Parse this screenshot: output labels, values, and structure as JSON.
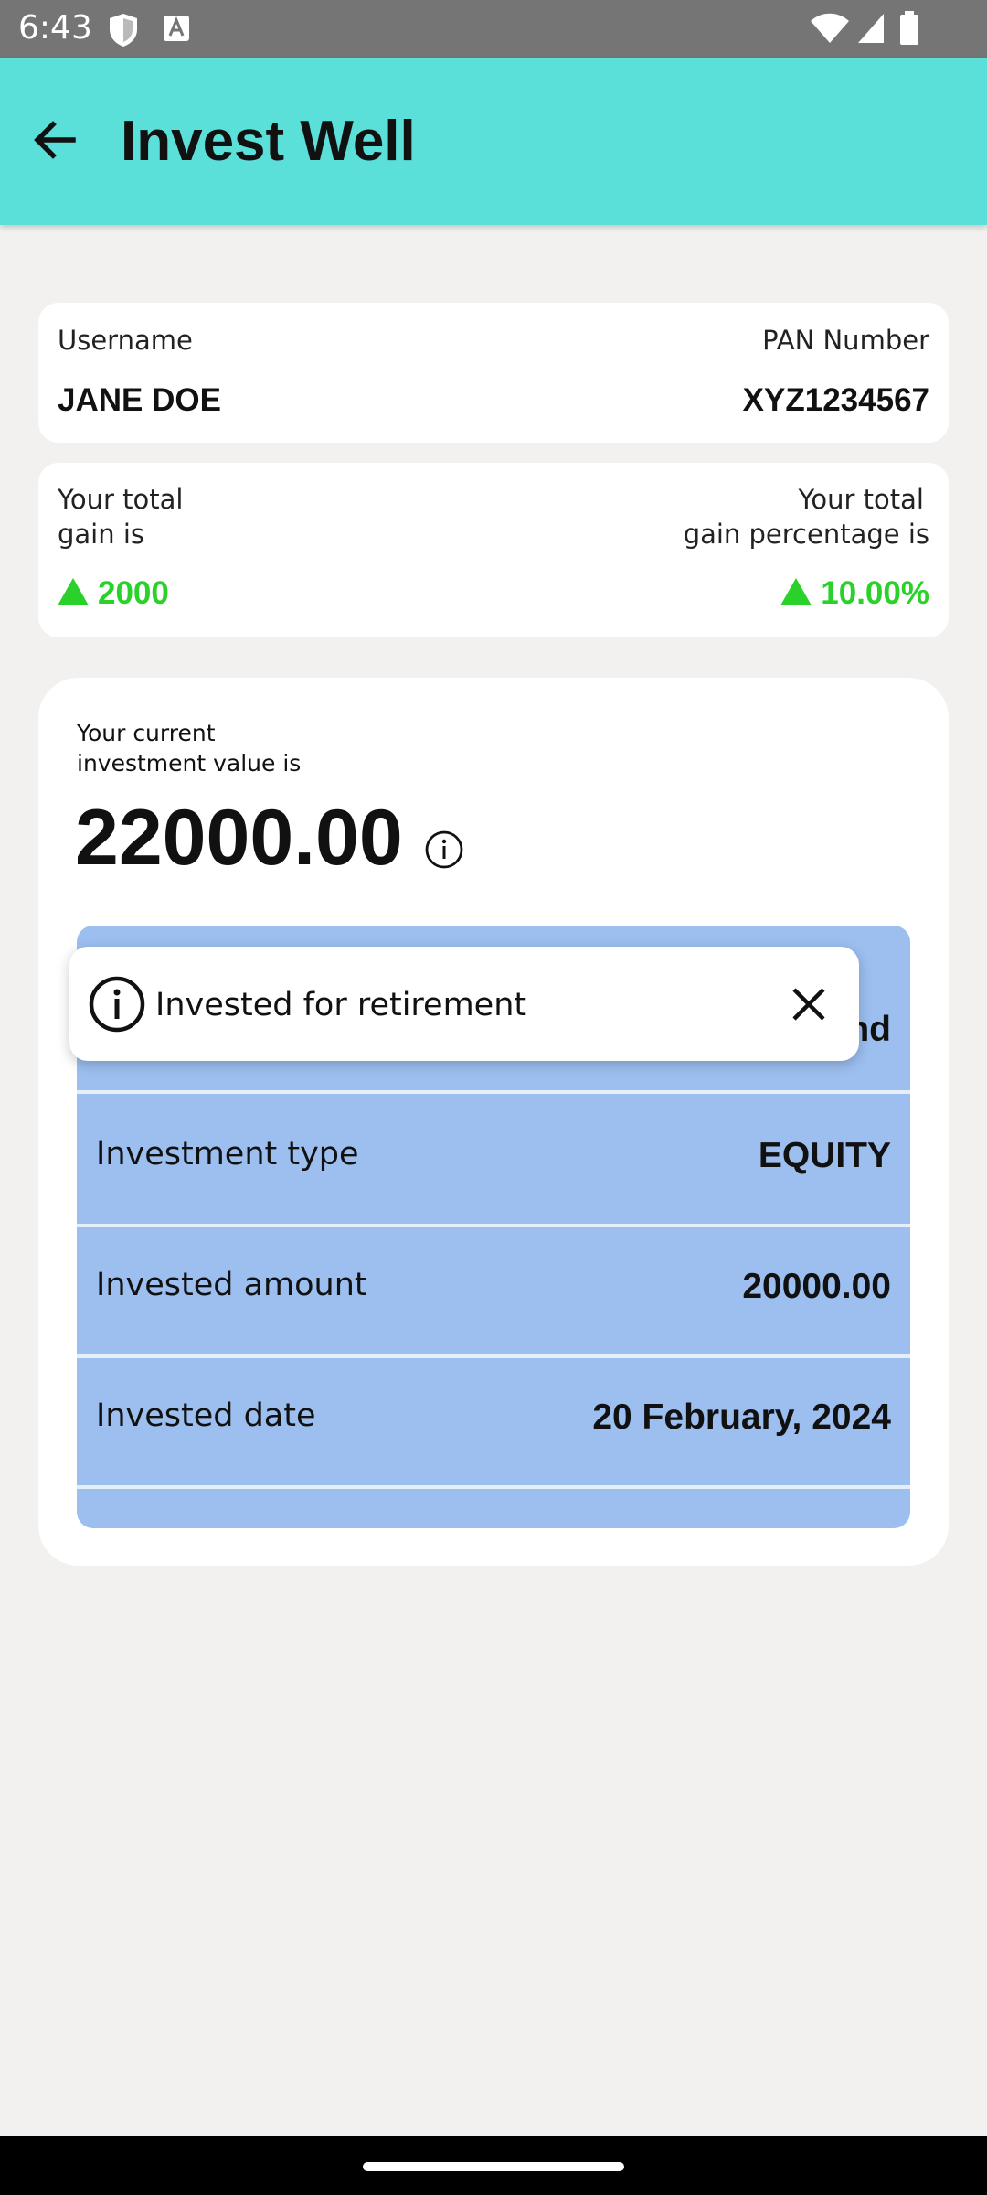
{
  "status_bar": {
    "time": "6:43"
  },
  "app_bar": {
    "title": "Invest Well"
  },
  "user_card": {
    "username_label": "Username",
    "username": "JANE DOE",
    "pan_label": "PAN Number",
    "pan": "XYZ1234567"
  },
  "gain_card": {
    "total_gain_label_1": "Your total",
    "total_gain_label_2": "gain is",
    "total_gain": "2000",
    "gain_pct_label_1": "Your total",
    "gain_pct_label_2": "gain percentage is",
    "gain_pct": "10.00%",
    "gain_color": "#2bd12b"
  },
  "investment_card": {
    "label_1": "Your current",
    "label_2": "investment value is",
    "value": "22000.00",
    "rows": [
      {
        "key": "",
        "value": "nd"
      },
      {
        "key": "Investment type",
        "value": "EQUITY"
      },
      {
        "key": "Invested amount",
        "value": "20000.00"
      },
      {
        "key": "Invested date",
        "value": "20 February, 2024"
      }
    ]
  },
  "tooltip": {
    "text": "Invested for retirement"
  },
  "colors": {
    "app_bar": "#5adfd9",
    "list_bg": "#9cbff0",
    "background": "#f2f1f0"
  }
}
